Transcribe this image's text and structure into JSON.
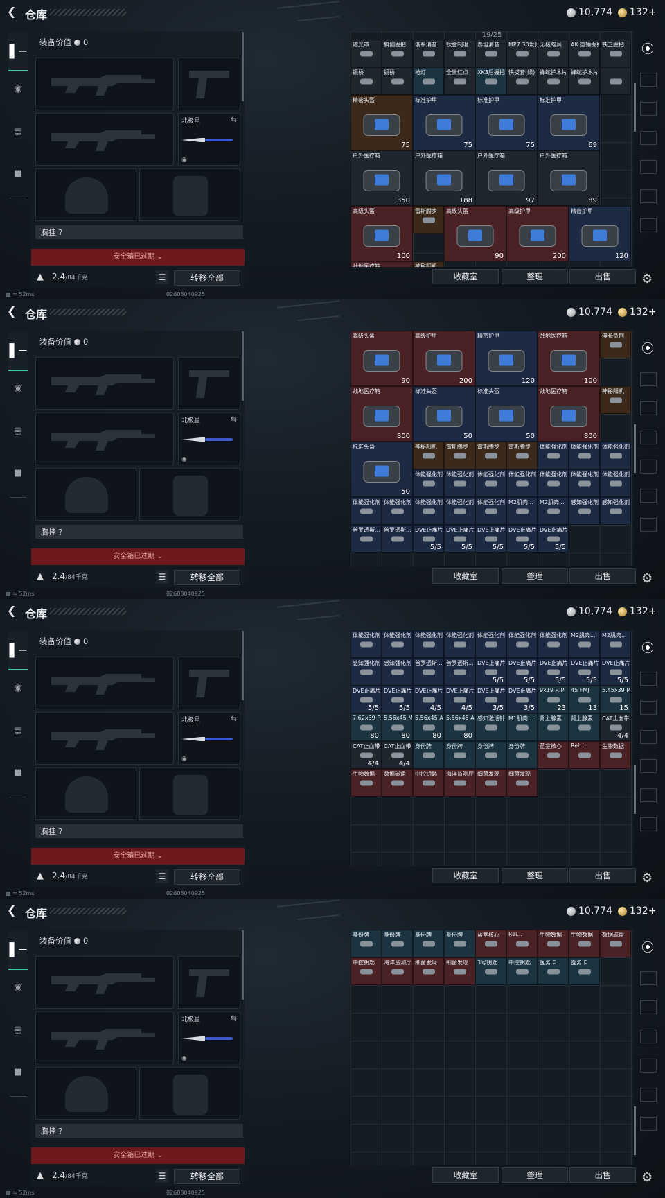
{
  "page": {
    "title": "仓库"
  },
  "currency": {
    "silver": "10,774",
    "gold": "132+"
  },
  "loadout": {
    "value_label": "装备价值",
    "value": "0",
    "melee_name": "北极星",
    "chest_rig_label": "胸挂 ?",
    "safebox_expired": "安全箱已过期",
    "weight": "2.4",
    "weight_capacity": "/84千克",
    "transfer_all": "转移全部"
  },
  "stash": {
    "capacity": "19/25",
    "buttons": {
      "collection": "收藏室",
      "sort": "整理",
      "sell": "出售"
    }
  },
  "status": {
    "ping": "52ms",
    "serial": "02608040925"
  },
  "frames": [
    {
      "cells": [
        {
          "n": "遮光罩",
          "c": "c-dark"
        },
        {
          "n": "斜侧握把",
          "c": "c-dark"
        },
        {
          "n": "俄系消音",
          "c": "c-dark"
        },
        {
          "n": "钛金制退",
          "c": "c-dark"
        },
        {
          "n": "泰坦消音",
          "c": "c-dark"
        },
        {
          "n": "MP7 30发弹匣",
          "c": "c-dark"
        },
        {
          "n": "无极瞄具",
          "c": "c-dark"
        },
        {
          "n": "AK 重锤握把",
          "c": "c-dark"
        },
        {
          "n": "铁卫握把",
          "c": "c-dark"
        },
        {
          "n": "镜桥",
          "c": "c-dark"
        },
        {
          "n": "镜桥",
          "c": "c-dark"
        },
        {
          "n": "枪灯",
          "c": "c-teal"
        },
        {
          "n": "全景红点",
          "c": "c-dark"
        },
        {
          "n": "XK3后握把",
          "c": "c-teal"
        },
        {
          "n": "快拔套(绿)",
          "c": "c-dark"
        },
        {
          "n": "蜂蛇护木片",
          "c": "c-dark"
        },
        {
          "n": "蜂蛇护木片",
          "c": "c-dark"
        },
        {
          "n": "",
          "c": "c-dark"
        },
        {
          "n": "精密头盔",
          "c": "c-brown",
          "v": "75",
          "big": true
        },
        {
          "n": "标准护甲",
          "c": "c-blue",
          "v": "75",
          "big": true
        },
        {
          "n": "标准护甲",
          "c": "c-blue",
          "v": "75",
          "big": true
        },
        {
          "n": "标准护甲",
          "c": "c-blue",
          "v": "69",
          "big": true
        },
        {
          "n": "户外医疗箱",
          "c": "c-dark",
          "v": "350",
          "big": true
        },
        {
          "n": "户外医疗箱",
          "c": "c-dark",
          "v": "188",
          "big": true
        },
        {
          "n": "户外医疗箱",
          "c": "c-dark",
          "v": "97",
          "big": true
        },
        {
          "n": "户外医疗箱",
          "c": "c-dark",
          "v": "89",
          "big": true
        },
        {
          "n": "高级头盔",
          "c": "c-red",
          "v": "100",
          "big": true
        },
        {
          "n": "雷斯腾步",
          "c": "c-brown"
        },
        {
          "n": "高级头盔",
          "c": "c-red",
          "v": "90",
          "big": true
        },
        {
          "n": "高级护甲",
          "c": "c-red",
          "v": "200",
          "big": true
        },
        {
          "n": "精密护甲",
          "c": "c-blue",
          "v": "120",
          "big": true
        },
        {
          "n": "战地医疗箱",
          "c": "c-red",
          "big": true
        },
        {
          "n": "神秘阳机",
          "c": "c-brown"
        }
      ]
    },
    {
      "cells": [
        {
          "n": "高级头盔",
          "c": "c-red",
          "v": "90",
          "big": true
        },
        {
          "n": "高级护甲",
          "c": "c-red",
          "v": "200",
          "big": true
        },
        {
          "n": "精密护甲",
          "c": "c-blue",
          "v": "120",
          "big": true
        },
        {
          "n": "战地医疗箱",
          "c": "c-red",
          "v": "100",
          "big": true
        },
        {
          "n": "漫长负荆",
          "c": "c-brown"
        },
        {
          "n": "战地医疗箱",
          "c": "c-red",
          "v": "800",
          "big": true
        },
        {
          "n": "标准头盔",
          "c": "c-blue",
          "v": "50",
          "big": true
        },
        {
          "n": "标准头盔",
          "c": "c-blue",
          "v": "50",
          "big": true
        },
        {
          "n": "战地医疗箱",
          "c": "c-red",
          "v": "800",
          "big": true
        },
        {
          "n": "神秘阳机",
          "c": "c-brown"
        },
        {
          "n": "标准头盔",
          "c": "c-blue",
          "v": "50",
          "big": true
        },
        {
          "n": "神秘阳机",
          "c": "c-brown"
        },
        {
          "n": "雷斯腾步",
          "c": "c-brown"
        },
        {
          "n": "雷斯腾步",
          "c": "c-brown"
        },
        {
          "n": "雷斯腾步",
          "c": "c-brown"
        },
        {
          "n": "体能强化剂",
          "c": "c-blue"
        },
        {
          "n": "体能强化剂",
          "c": "c-blue"
        },
        {
          "n": "体能强化剂",
          "c": "c-blue"
        },
        {
          "n": "体能强化剂",
          "c": "c-blue"
        },
        {
          "n": "体能强化剂",
          "c": "c-blue"
        },
        {
          "n": "体能强化剂",
          "c": "c-blue"
        },
        {
          "n": "体能强化剂",
          "c": "c-blue"
        },
        {
          "n": "体能强化剂",
          "c": "c-blue"
        },
        {
          "n": "体能强化剂",
          "c": "c-blue"
        },
        {
          "n": "体能强化剂",
          "c": "c-blue"
        },
        {
          "n": "体能强化剂",
          "c": "c-blue"
        },
        {
          "n": "体能强化剂",
          "c": "c-blue"
        },
        {
          "n": "体能强化剂",
          "c": "c-blue"
        },
        {
          "n": "体能强化剂",
          "c": "c-blue"
        },
        {
          "n": "体能强化剂",
          "c": "c-blue"
        },
        {
          "n": "M2肌肉...",
          "c": "c-blue"
        },
        {
          "n": "M2肌肉...",
          "c": "c-blue"
        },
        {
          "n": "感知强化剂",
          "c": "c-blue"
        },
        {
          "n": "感知强化剂",
          "c": "c-blue"
        },
        {
          "n": "普罗透斯...",
          "c": "c-blue"
        },
        {
          "n": "普罗透斯...",
          "c": "c-blue"
        },
        {
          "n": "DVE止痛片",
          "c": "c-blue",
          "v": "5/5"
        },
        {
          "n": "DVE止痛片",
          "c": "c-blue",
          "v": "5/5"
        },
        {
          "n": "DVE止痛片",
          "c": "c-blue",
          "v": "5/5"
        },
        {
          "n": "DVE止痛片",
          "c": "c-blue",
          "v": "5/5"
        },
        {
          "n": "DVE止痛片",
          "c": "c-blue",
          "v": "5/5"
        }
      ]
    },
    {
      "cells": [
        {
          "n": "体能强化剂",
          "c": "c-blue"
        },
        {
          "n": "体能强化剂",
          "c": "c-blue"
        },
        {
          "n": "体能强化剂",
          "c": "c-blue"
        },
        {
          "n": "体能强化剂",
          "c": "c-blue"
        },
        {
          "n": "体能强化剂",
          "c": "c-blue"
        },
        {
          "n": "体能强化剂",
          "c": "c-blue"
        },
        {
          "n": "体能强化剂",
          "c": "c-blue"
        },
        {
          "n": "M2肌肉...",
          "c": "c-blue"
        },
        {
          "n": "M2肌肉...",
          "c": "c-blue"
        },
        {
          "n": "感知强化剂",
          "c": "c-blue"
        },
        {
          "n": "感知强化剂",
          "c": "c-blue"
        },
        {
          "n": "普罗透斯...",
          "c": "c-blue"
        },
        {
          "n": "普罗透斯...",
          "c": "c-blue"
        },
        {
          "n": "DVE止痛片",
          "c": "c-blue",
          "v": "5/5"
        },
        {
          "n": "DVE止痛片",
          "c": "c-blue",
          "v": "5/5"
        },
        {
          "n": "DVE止痛片",
          "c": "c-blue",
          "v": "5/5"
        },
        {
          "n": "DVE止痛片",
          "c": "c-blue",
          "v": "5/5"
        },
        {
          "n": "DVE止痛片",
          "c": "c-blue",
          "v": "5/5"
        },
        {
          "n": "DVE止痛片",
          "c": "c-blue",
          "v": "5/5"
        },
        {
          "n": "DVE止痛片",
          "c": "c-blue",
          "v": "5/5"
        },
        {
          "n": "DVE止痛片",
          "c": "c-blue",
          "v": "4/5"
        },
        {
          "n": "DVE止痛片",
          "c": "c-blue",
          "v": "4/5"
        },
        {
          "n": "DVE止痛片",
          "c": "c-blue",
          "v": "3/5"
        },
        {
          "n": "DVE止痛片",
          "c": "c-blue",
          "v": "3/5"
        },
        {
          "n": "9x19 RIP",
          "c": "c-teal",
          "v": "23"
        },
        {
          "n": "45 FMJ",
          "c": "c-teal",
          "v": "13"
        },
        {
          "n": "5.45x39 PS",
          "c": "c-teal",
          "v": "15"
        },
        {
          "n": "7.62x39 PS",
          "c": "c-teal",
          "v": "80"
        },
        {
          "n": "5.56x45 M855",
          "c": "c-teal",
          "v": "80"
        },
        {
          "n": "5.56x45 AP",
          "c": "c-teal",
          "v": "80"
        },
        {
          "n": "5.56x45 AP",
          "c": "c-teal",
          "v": "80"
        },
        {
          "n": "感知激活针",
          "c": "c-teal"
        },
        {
          "n": "M1肌肉...",
          "c": "c-teal"
        },
        {
          "n": "肾上腺素",
          "c": "c-teal"
        },
        {
          "n": "肾上腺素",
          "c": "c-teal"
        },
        {
          "n": "CAT止血带",
          "c": "c-dark",
          "v": "4/4"
        },
        {
          "n": "CAT止血带",
          "c": "c-dark",
          "v": "4/4"
        },
        {
          "n": "CAT止血带",
          "c": "c-dark",
          "v": "4/4"
        },
        {
          "n": "身份牌",
          "c": "c-teal"
        },
        {
          "n": "身份牌",
          "c": "c-teal"
        },
        {
          "n": "身份牌",
          "c": "c-teal"
        },
        {
          "n": "身份牌",
          "c": "c-teal"
        },
        {
          "n": "蓝室核心",
          "c": "c-red"
        },
        {
          "n": "Rel...",
          "c": "c-red"
        },
        {
          "n": "生物数据",
          "c": "c-red"
        },
        {
          "n": "生物数据",
          "c": "c-red"
        },
        {
          "n": "数据磁盘",
          "c": "c-red"
        },
        {
          "n": "中控钥匙",
          "c": "c-red"
        },
        {
          "n": "海洋监测厅",
          "c": "c-red"
        },
        {
          "n": "细菌发现",
          "c": "c-red"
        },
        {
          "n": "细菌发现",
          "c": "c-red"
        }
      ]
    },
    {
      "cells": [
        {
          "n": "身份牌",
          "c": "c-teal"
        },
        {
          "n": "身份牌",
          "c": "c-teal"
        },
        {
          "n": "身份牌",
          "c": "c-teal"
        },
        {
          "n": "身份牌",
          "c": "c-teal"
        },
        {
          "n": "蓝室核心",
          "c": "c-red"
        },
        {
          "n": "Rel...",
          "c": "c-red"
        },
        {
          "n": "生物数据",
          "c": "c-red"
        },
        {
          "n": "生物数据",
          "c": "c-red"
        },
        {
          "n": "数据磁盘",
          "c": "c-red"
        },
        {
          "n": "中控钥匙",
          "c": "c-red"
        },
        {
          "n": "海洋监测厅",
          "c": "c-red"
        },
        {
          "n": "细菌发现",
          "c": "c-red"
        },
        {
          "n": "细菌发现",
          "c": "c-red"
        },
        {
          "n": "3号钥匙",
          "c": "c-teal"
        },
        {
          "n": "中控钥匙",
          "c": "c-teal"
        },
        {
          "n": "医务卡",
          "c": "c-teal"
        },
        {
          "n": "医务卡",
          "c": "c-teal"
        }
      ]
    }
  ]
}
